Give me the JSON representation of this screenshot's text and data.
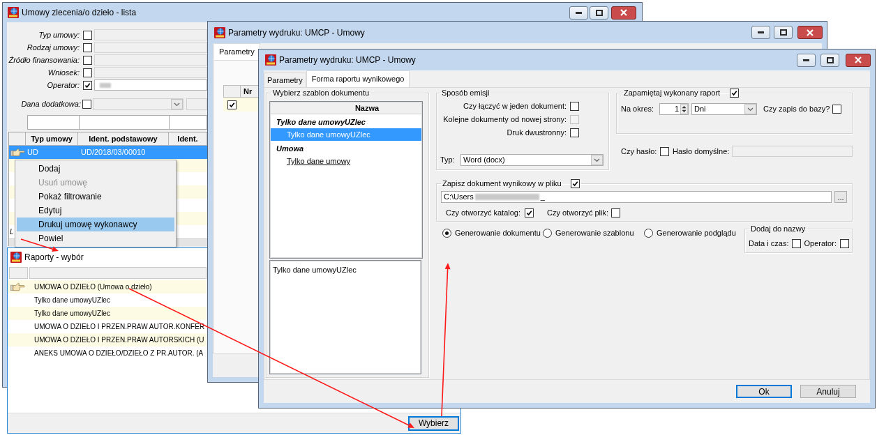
{
  "list_window": {
    "title": "Umowy zlecenia/o dzieło - lista",
    "filters": [
      {
        "label": "Typ umowy:",
        "checked": false
      },
      {
        "label": "Rodzaj umowy:",
        "checked": false
      },
      {
        "label": "Źródło finansowania:",
        "checked": false
      },
      {
        "label": "Wniosek:",
        "checked": false
      },
      {
        "label": "Operator:",
        "checked": true,
        "redacted": true
      }
    ],
    "extra_filter": {
      "label": "Dana dodatkowa:",
      "checked": false
    },
    "table": {
      "columns": [
        "Typ umowy",
        "Ident. podstawowy",
        "Ident."
      ],
      "rows": [
        {
          "cells": [
            "UD",
            "UD/2018/03/00010"
          ],
          "selected": true,
          "current": true
        }
      ]
    },
    "footer_text": "L"
  },
  "context_menu": {
    "items": [
      {
        "label": "Dodaj",
        "disabled": false,
        "selected": false
      },
      {
        "label": "Usuń umowę",
        "disabled": true,
        "selected": false
      },
      {
        "label": "Pokaż filtrowanie",
        "disabled": false,
        "selected": false
      },
      {
        "label": "Edytuj",
        "disabled": false,
        "selected": false
      },
      {
        "label": "Drukuj umowę wykonawcy",
        "disabled": false,
        "selected": true
      },
      {
        "label": "Powiel",
        "disabled": false,
        "selected": false
      }
    ]
  },
  "reports_window": {
    "title": "Raporty - wybór",
    "rows": [
      {
        "label": "UMOWA O DZIEŁO (Umowa o dzieło)",
        "current": true
      },
      {
        "label": "Tylko dane umowyUZlec",
        "current": false
      },
      {
        "label": "Tylko dane umowyUZlec",
        "current": false
      },
      {
        "label": "UMOWA O DZIEŁO I PRZEN.PRAW AUTOR.KONFER",
        "current": false
      },
      {
        "label": "UMOWA O DZIEŁO I PRZEN.PRAW AUTORSKICH (U",
        "current": false
      },
      {
        "label": "ANEKS UMOWA O DZIEŁO/DZIEŁO Z PR.AUTOR. (A",
        "current": false
      }
    ],
    "button": "Wybierz"
  },
  "params_window_back": {
    "title": "Parametry wydruku: UMCP - Umowy",
    "tabs": [
      {
        "label": "Parametry",
        "selected": true
      }
    ],
    "table": {
      "columns": [
        "Nr"
      ],
      "rows": [
        {
          "checked": true
        }
      ]
    }
  },
  "params_window": {
    "title": "Parametry wydruku: UMCP - Umowy",
    "tabs": [
      {
        "label": "Parametry",
        "selected": false
      },
      {
        "label": "Forma raportu wynikowego",
        "selected": true
      }
    ],
    "template_group": {
      "title": "Wybierz szablon dokumentu",
      "column": "Nazwa",
      "tree": [
        {
          "label": "Tylko dane umowyUZlec",
          "children": [
            {
              "label": "Tylko dane umowyUZlec",
              "selected": true,
              "hover": false
            }
          ]
        },
        {
          "label": "Umowa",
          "children": [
            {
              "label": "Tylko dane umowy",
              "selected": false,
              "hover": true
            }
          ]
        }
      ],
      "description": "Tylko dane umowyUZlec"
    },
    "emission": {
      "title": "Sposób emisji",
      "options": [
        {
          "label": "Czy łączyć w jeden dokument:",
          "checked": false,
          "disabled": false
        },
        {
          "label": "Kolejne dokumenty od nowej strony:",
          "checked": false,
          "disabled": true
        },
        {
          "label": "Druk dwustronny:",
          "checked": false,
          "disabled": false
        }
      ],
      "type_label": "Typ:",
      "type_value": "Word (docx)"
    },
    "remember": {
      "title": "Zapamiętaj wykonany raport",
      "checked": true,
      "period_label": "Na okres:",
      "period_value": "1",
      "period_unit": "Dni",
      "db_label": "Czy zapis do bazy?",
      "db_checked": false
    },
    "password": {
      "label": "Czy hasło:",
      "checked": false,
      "default_label": "Hasło domyślne:"
    },
    "save_file": {
      "title": "Zapisz dokument wynikowy w pliku",
      "checked": true,
      "path_start": "C:\\Users",
      "path_end": "_",
      "redacted": true,
      "browse": "...",
      "open_options": [
        {
          "label": "Czy otworzyć katalog:",
          "checked": true
        },
        {
          "label": "Czy otworzyć plik:",
          "checked": false
        }
      ]
    },
    "modes": [
      {
        "label": "Generowanie dokumentu",
        "selected": true
      },
      {
        "label": "Generowanie szablonu",
        "selected": false
      },
      {
        "label": "Generowanie podglądu",
        "selected": false
      }
    ],
    "add_to_name": {
      "title": "Dodaj do nazwy",
      "options": [
        {
          "label": "Data i czas:",
          "checked": false
        },
        {
          "label": "Operator:",
          "checked": false
        }
      ]
    },
    "buttons": [
      {
        "label": "Ok",
        "default": true
      },
      {
        "label": "Anuluj",
        "default": false
      }
    ]
  }
}
